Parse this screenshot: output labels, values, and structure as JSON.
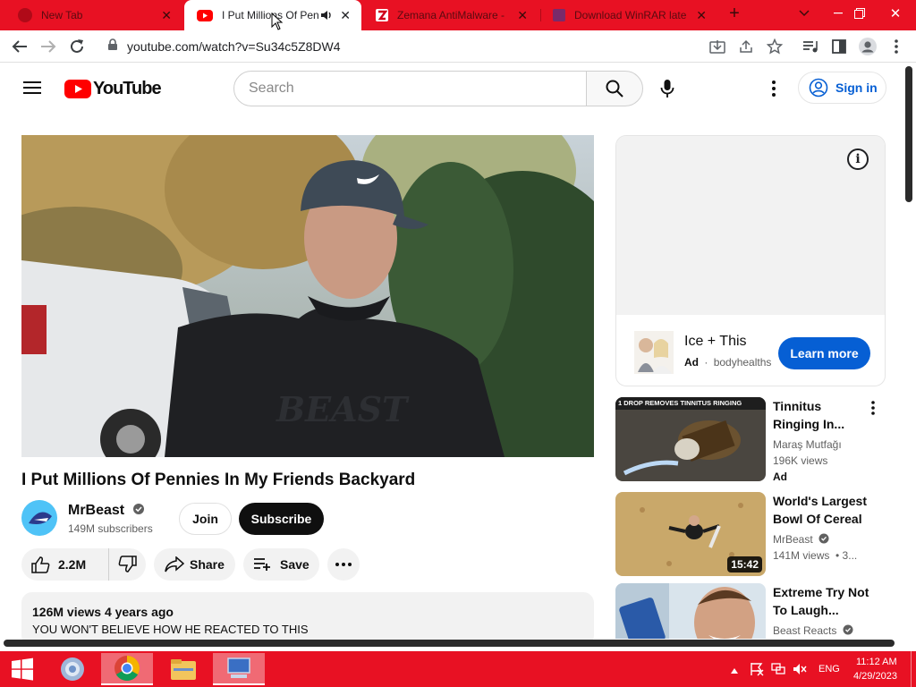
{
  "browser": {
    "tabs": [
      {
        "title": "New Tab",
        "active": false
      },
      {
        "title": "I Put Millions Of Pen",
        "active": true
      },
      {
        "title": "Zemana AntiMalware -",
        "active": false
      },
      {
        "title": "Download WinRAR late",
        "active": false
      }
    ],
    "url": "youtube.com/watch?v=Su34c5Z8DW4",
    "tab_accent": "#e81123"
  },
  "youtube": {
    "logo_text": "YouTube",
    "search_placeholder": "Search",
    "signin_label": "Sign in",
    "video": {
      "title": "I Put Millions Of Pennies In My Friends Backyard",
      "channel": "MrBeast",
      "subscribers": "149M subscribers",
      "join_label": "Join",
      "subscribe_label": "Subscribe",
      "likes": "2.2M",
      "share_label": "Share",
      "save_label": "Save",
      "views_and_date": "126M views  4 years ago",
      "description": "YOU WON'T BELIEVE HOW HE REACTED TO THIS"
    },
    "ad": {
      "title": "Ice + This",
      "badge": "Ad",
      "advertiser": "bodyhealths",
      "cta": "Learn more"
    },
    "recommendations": [
      {
        "title": "Tinnitus Ringing In...",
        "channel": "Maraş Mutfağı",
        "views": "196K views",
        "badge": "Ad",
        "thumb_text": "1 DROP REMOVES TINNITUS RINGING"
      },
      {
        "title": "World's Largest Bowl Of Cereal",
        "channel": "MrBeast",
        "views": "141M views  • 3...",
        "duration": "15:42"
      },
      {
        "title": "Extreme Try Not To Laugh...",
        "channel": "Beast Reacts"
      }
    ]
  },
  "taskbar": {
    "language": "ENG",
    "time": "11:12 AM",
    "date": "4/29/2023"
  }
}
